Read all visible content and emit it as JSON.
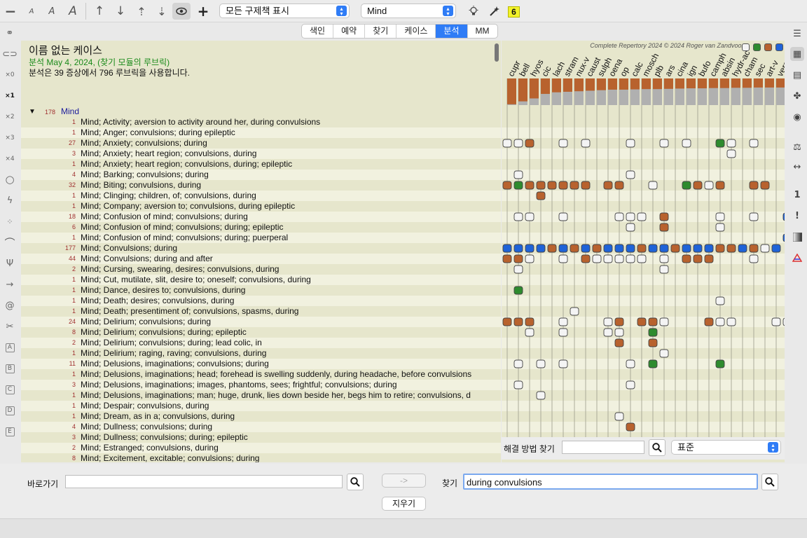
{
  "toolbar": {
    "filter_select": "모든 구제책 표시",
    "section_select": "Mind",
    "badge": "6"
  },
  "tabs": [
    {
      "label": "색인",
      "active": false
    },
    {
      "label": "예약",
      "active": false
    },
    {
      "label": "찾기",
      "active": false
    },
    {
      "label": "케이스",
      "active": false
    },
    {
      "label": "분석",
      "active": true
    },
    {
      "label": "MM",
      "active": false
    }
  ],
  "case": {
    "title": "이름 없는 케이스",
    "date_line": "분석 May 4, 2024, (찾기 모듈의 루브릭)",
    "info_line": "분석은 39 증상에서 796 루브릭을 사용합니다."
  },
  "section": {
    "count": "178",
    "name": "Mind"
  },
  "rubrics": [
    {
      "count": "1",
      "text": "Mind; Activity; aversion to activity around her, during convulsions"
    },
    {
      "count": "1",
      "text": "Mind; Anger; convulsions; during epileptic"
    },
    {
      "count": "27",
      "text": "Mind; Anxiety; convulsions; during"
    },
    {
      "count": "3",
      "text": "Mind; Anxiety; heart region; convulsions, during"
    },
    {
      "count": "1",
      "text": "Mind; Anxiety; heart region; convulsions, during; epileptic"
    },
    {
      "count": "4",
      "text": "Mind; Barking; convulsions; during"
    },
    {
      "count": "32",
      "text": "Mind; Biting; convulsions, during"
    },
    {
      "count": "1",
      "text": "Mind; Clinging; children, of; convulsions, during"
    },
    {
      "count": "1",
      "text": "Mind; Company; aversion to; convulsions, during epileptic"
    },
    {
      "count": "18",
      "text": "Mind; Confusion of mind; convulsions; during"
    },
    {
      "count": "6",
      "text": "Mind; Confusion of mind; convulsions; during; epileptic"
    },
    {
      "count": "1",
      "text": "Mind; Confusion of mind; convulsions; during; puerperal"
    },
    {
      "count": "177",
      "text": "Mind; Convulsions; during"
    },
    {
      "count": "44",
      "text": "Mind; Convulsions; during and after"
    },
    {
      "count": "2",
      "text": "Mind; Cursing, swearing, desires; convulsions, during"
    },
    {
      "count": "1",
      "text": "Mind; Cut, mutilate, slit, desire to; oneself; convulsions, during"
    },
    {
      "count": "1",
      "text": "Mind; Dance, desires to; convulsions, during"
    },
    {
      "count": "1",
      "text": "Mind; Death; desires; convulsions, during"
    },
    {
      "count": "1",
      "text": "Mind; Death; presentiment of; convulsions, spasms, during"
    },
    {
      "count": "24",
      "text": "Mind; Delirium; convulsions; during"
    },
    {
      "count": "8",
      "text": "Mind; Delirium; convulsions; during; epileptic"
    },
    {
      "count": "2",
      "text": "Mind; Delirium; convulsions; during; lead colic, in"
    },
    {
      "count": "1",
      "text": "Mind; Delirium; raging, raving; convulsions, during"
    },
    {
      "count": "11",
      "text": "Mind; Delusions, imaginations; convulsions; during"
    },
    {
      "count": "1",
      "text": "Mind; Delusions, imaginations; head; forehead is swelling suddenly, during headache, before convulsions"
    },
    {
      "count": "3",
      "text": "Mind; Delusions, imaginations; images, phantoms, sees; frightful; convulsions; during"
    },
    {
      "count": "1",
      "text": "Mind; Delusions, imaginations; man; huge, drunk, lies down beside her, begs him to retire; convulsions, d"
    },
    {
      "count": "1",
      "text": "Mind; Despair; convulsions, during"
    },
    {
      "count": "1",
      "text": "Mind; Dream, as in a; convulsions, during"
    },
    {
      "count": "4",
      "text": "Mind; Dullness; convulsions; during"
    },
    {
      "count": "3",
      "text": "Mind; Dullness; convulsions; during; epileptic"
    },
    {
      "count": "2",
      "text": "Mind; Estranged; convulsions, during"
    },
    {
      "count": "8",
      "text": "Mind; Excitement, excitable; convulsions; during"
    }
  ],
  "grid": {
    "copyright": "Complete Repertory 2024 © 2024 Roger van Zandvoort",
    "remedies": [
      "cupr",
      "bell",
      "hyos",
      "cic",
      "lach",
      "stram",
      "nux-v",
      "caust",
      "sulph",
      "oena",
      "op",
      "calc",
      "mosch",
      "plb",
      "ars",
      "cina",
      "ign",
      "bufo",
      "camph",
      "absin",
      "hydr-ac",
      "cham",
      "sec",
      "art-v",
      "verat"
    ],
    "score_fraction": [
      0.97,
      0.86,
      0.75,
      0.58,
      0.52,
      0.5,
      0.48,
      0.46,
      0.44,
      0.42,
      0.42,
      0.41,
      0.4,
      0.4,
      0.39,
      0.38,
      0.37,
      0.37,
      0.36,
      0.36,
      0.35,
      0.35,
      0.34,
      0.34,
      0.34
    ],
    "colors": {
      "white": "#f4f4f4",
      "brown": "#b8622e",
      "green": "#2e8b2e",
      "blue": "#1f63d8"
    },
    "cells": [
      [],
      [],
      [
        [
          0,
          "w"
        ],
        [
          1,
          "w"
        ],
        [
          2,
          "b"
        ],
        [
          5,
          "w"
        ],
        [
          7,
          "w"
        ],
        [
          11,
          "w"
        ],
        [
          14,
          "w"
        ],
        [
          16,
          "w"
        ],
        [
          19,
          "g"
        ],
        [
          20,
          "w"
        ],
        [
          22,
          "w"
        ]
      ],
      [
        [
          20,
          "w"
        ]
      ],
      [],
      [
        [
          1,
          "w"
        ],
        [
          11,
          "w"
        ]
      ],
      [
        [
          0,
          "b"
        ],
        [
          1,
          "g"
        ],
        [
          2,
          "b"
        ],
        [
          3,
          "b"
        ],
        [
          4,
          "b"
        ],
        [
          5,
          "b"
        ],
        [
          6,
          "b"
        ],
        [
          7,
          "b"
        ],
        [
          9,
          "b"
        ],
        [
          10,
          "b"
        ],
        [
          13,
          "w"
        ],
        [
          16,
          "g"
        ],
        [
          17,
          "b"
        ],
        [
          18,
          "w"
        ],
        [
          19,
          "b"
        ],
        [
          22,
          "b"
        ],
        [
          23,
          "b"
        ]
      ],
      [
        [
          3,
          "b"
        ]
      ],
      [],
      [
        [
          1,
          "w"
        ],
        [
          2,
          "w"
        ],
        [
          5,
          "w"
        ],
        [
          10,
          "w"
        ],
        [
          11,
          "w"
        ],
        [
          12,
          "w"
        ],
        [
          14,
          "b"
        ],
        [
          19,
          "w"
        ],
        [
          22,
          "w"
        ],
        [
          25,
          "u"
        ]
      ],
      [
        [
          11,
          "w"
        ],
        [
          14,
          "b"
        ],
        [
          19,
          "w"
        ]
      ],
      [
        [
          25,
          "u"
        ]
      ],
      [
        [
          0,
          "u"
        ],
        [
          1,
          "u"
        ],
        [
          2,
          "u"
        ],
        [
          3,
          "u"
        ],
        [
          4,
          "b"
        ],
        [
          5,
          "u"
        ],
        [
          6,
          "b"
        ],
        [
          7,
          "u"
        ],
        [
          8,
          "b"
        ],
        [
          9,
          "u"
        ],
        [
          10,
          "u"
        ],
        [
          11,
          "u"
        ],
        [
          12,
          "b"
        ],
        [
          13,
          "u"
        ],
        [
          14,
          "u"
        ],
        [
          15,
          "b"
        ],
        [
          16,
          "u"
        ],
        [
          17,
          "u"
        ],
        [
          18,
          "u"
        ],
        [
          19,
          "b"
        ],
        [
          20,
          "b"
        ],
        [
          21,
          "u"
        ],
        [
          22,
          "b"
        ],
        [
          23,
          "w"
        ],
        [
          24,
          "u"
        ]
      ],
      [
        [
          0,
          "b"
        ],
        [
          1,
          "b"
        ],
        [
          2,
          "w"
        ],
        [
          5,
          "w"
        ],
        [
          7,
          "b"
        ],
        [
          8,
          "w"
        ],
        [
          9,
          "w"
        ],
        [
          10,
          "w"
        ],
        [
          11,
          "w"
        ],
        [
          12,
          "w"
        ],
        [
          14,
          "w"
        ],
        [
          16,
          "b"
        ],
        [
          17,
          "b"
        ],
        [
          18,
          "b"
        ],
        [
          22,
          "w"
        ]
      ],
      [
        [
          1,
          "w"
        ],
        [
          14,
          "w"
        ]
      ],
      [],
      [
        [
          1,
          "g"
        ]
      ],
      [
        [
          19,
          "w"
        ]
      ],
      [
        [
          6,
          "w"
        ]
      ],
      [
        [
          0,
          "b"
        ],
        [
          1,
          "b"
        ],
        [
          2,
          "b"
        ],
        [
          5,
          "w"
        ],
        [
          9,
          "w"
        ],
        [
          10,
          "b"
        ],
        [
          12,
          "b"
        ],
        [
          13,
          "b"
        ],
        [
          14,
          "w"
        ],
        [
          18,
          "b"
        ],
        [
          19,
          "w"
        ],
        [
          20,
          "w"
        ],
        [
          24,
          "w"
        ],
        [
          25,
          "w"
        ]
      ],
      [
        [
          2,
          "w"
        ],
        [
          5,
          "w"
        ],
        [
          9,
          "w"
        ],
        [
          10,
          "w"
        ],
        [
          13,
          "g"
        ]
      ],
      [
        [
          10,
          "b"
        ],
        [
          13,
          "b"
        ]
      ],
      [
        [
          14,
          "w"
        ]
      ],
      [
        [
          1,
          "w"
        ],
        [
          3,
          "w"
        ],
        [
          5,
          "w"
        ],
        [
          11,
          "w"
        ],
        [
          13,
          "g"
        ],
        [
          19,
          "g"
        ]
      ],
      [],
      [
        [
          1,
          "w"
        ],
        [
          11,
          "w"
        ]
      ],
      [
        [
          3,
          "w"
        ]
      ],
      [],
      [
        [
          10,
          "w"
        ]
      ],
      [
        [
          11,
          "b"
        ]
      ],
      [],
      [],
      []
    ]
  },
  "solve": {
    "label": "해결 방법 찾기",
    "value": "",
    "select": "표준"
  },
  "bottom": {
    "goto_label": "바로가기",
    "goto_value": "",
    "arrow_btn": "->",
    "clear_btn": "지우기",
    "search_label": "찾기",
    "search_value": "during convulsions"
  }
}
